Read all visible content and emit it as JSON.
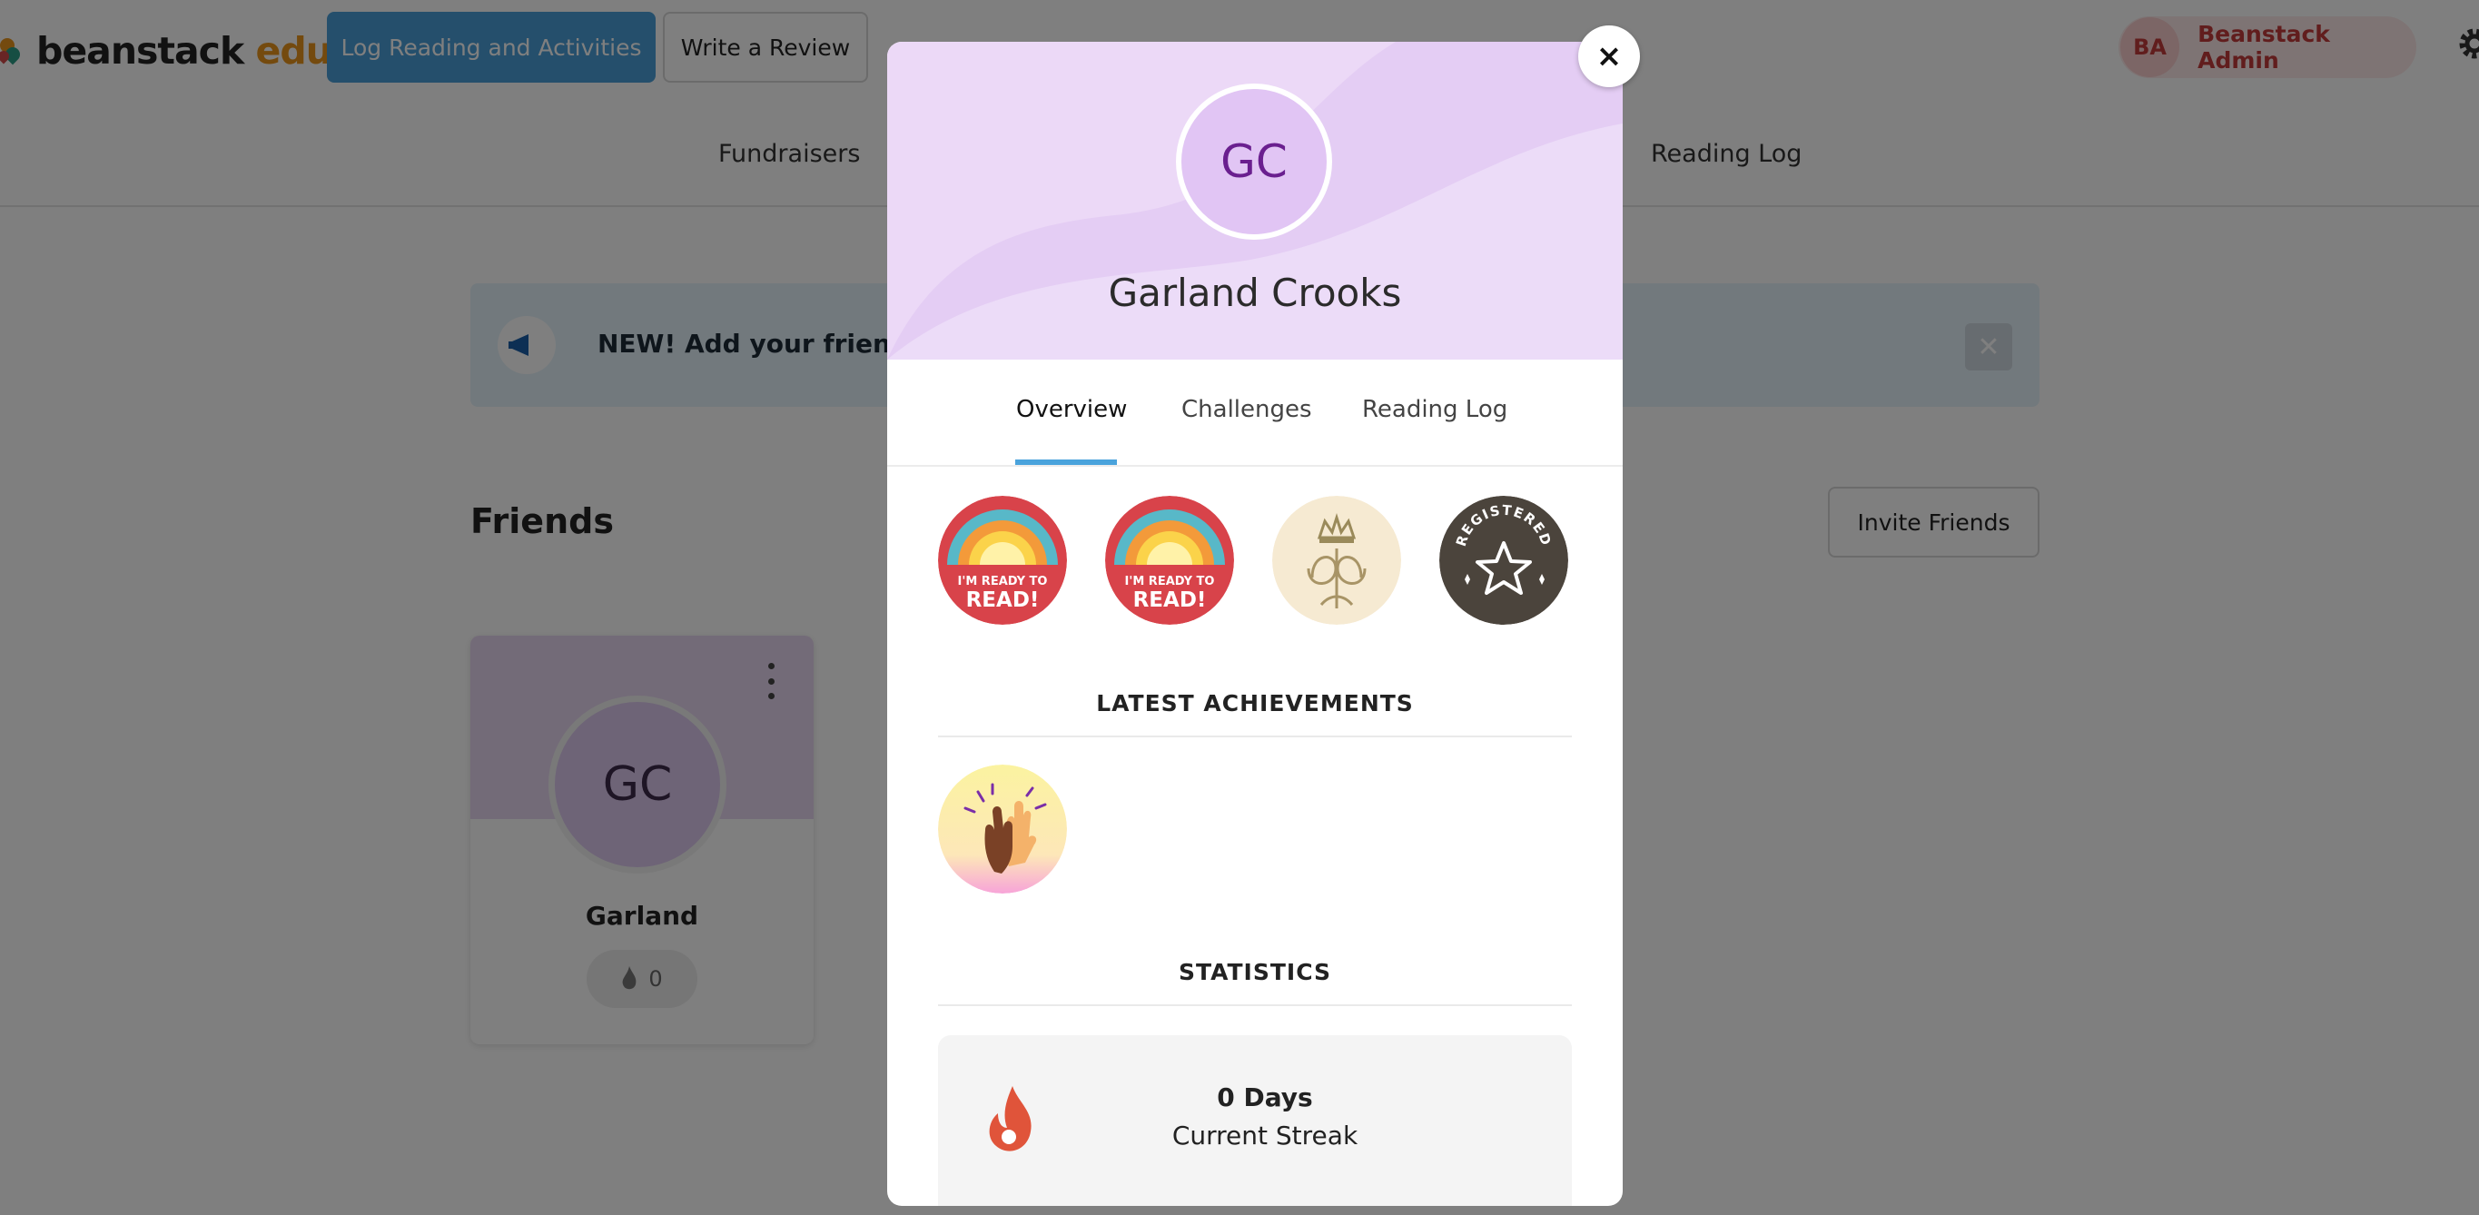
{
  "header": {
    "logo": {
      "brand": "beanstack",
      "suffix": "edu"
    },
    "log_button": "Log Reading and Activities",
    "review_button": "Write a Review",
    "user": {
      "initials": "BA",
      "name": "Beanstack Admin"
    },
    "settings_icon": "gear-icon"
  },
  "subnav": {
    "items": [
      "Fundraisers",
      "Reading Log"
    ]
  },
  "banner": {
    "text": "NEW! Add your friends",
    "icon": "megaphone-icon",
    "close_icon": "close-icon"
  },
  "friends": {
    "title": "Friends",
    "invite_button": "Invite Friends",
    "cards": [
      {
        "initials": "GC",
        "name": "Garland",
        "streak": "0"
      }
    ]
  },
  "modal": {
    "initials": "GC",
    "name": "Garland Crooks",
    "close_label": "×",
    "tabs": [
      "Overview",
      "Challenges",
      "Reading Log"
    ],
    "active_tab": "Overview",
    "badges": [
      {
        "name": "ready-to-read-badge",
        "line1": "I'M READY TO",
        "line2": "READ!"
      },
      {
        "name": "ready-to-read-badge",
        "line1": "I'M READY TO",
        "line2": "READ!"
      },
      {
        "name": "crown-monogram-badge"
      },
      {
        "name": "registered-star-badge",
        "text": "REGISTERED"
      }
    ],
    "achievements_title": "LATEST ACHIEVEMENTS",
    "achievements": [
      {
        "name": "high-five-badge"
      }
    ],
    "statistics_title": "STATISTICS",
    "stats": [
      {
        "value": "0 Days",
        "label": "Current Streak",
        "icon": "flame-icon"
      }
    ]
  },
  "colors": {
    "primary": "#4a9fd8",
    "modal_header": "#ecd9f7",
    "avatar_text": "#6a1f8f",
    "admin_accent": "#c23a3a",
    "flame": "#e0543a"
  }
}
